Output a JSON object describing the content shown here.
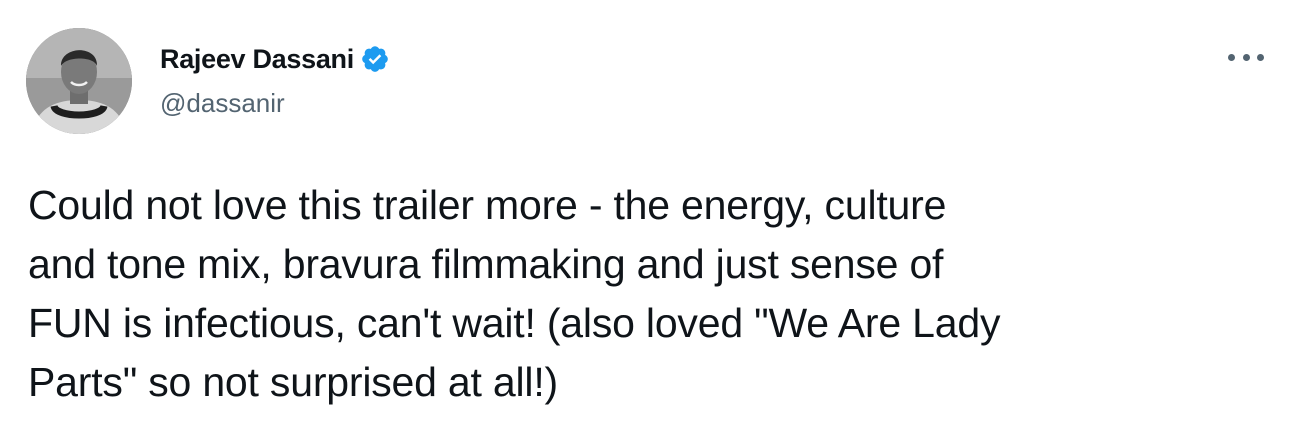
{
  "tweet": {
    "author": {
      "display_name": "Rajeev Dassani",
      "handle": "@dassanir",
      "verified": true,
      "avatar_icon": "profile-photo"
    },
    "text": "Could not love this trailer more - the energy, culture\nand tone mix, bravura filmmaking and just sense of\nFUN is infectious, can't wait! (also loved \"We Are Lady\nParts\" so not surprised at all!)",
    "more_icon": "more-options-icon"
  },
  "colors": {
    "text_primary": "#0f1419",
    "text_secondary": "#536471",
    "verified_blue": "#1d9bf0",
    "background": "#ffffff"
  }
}
